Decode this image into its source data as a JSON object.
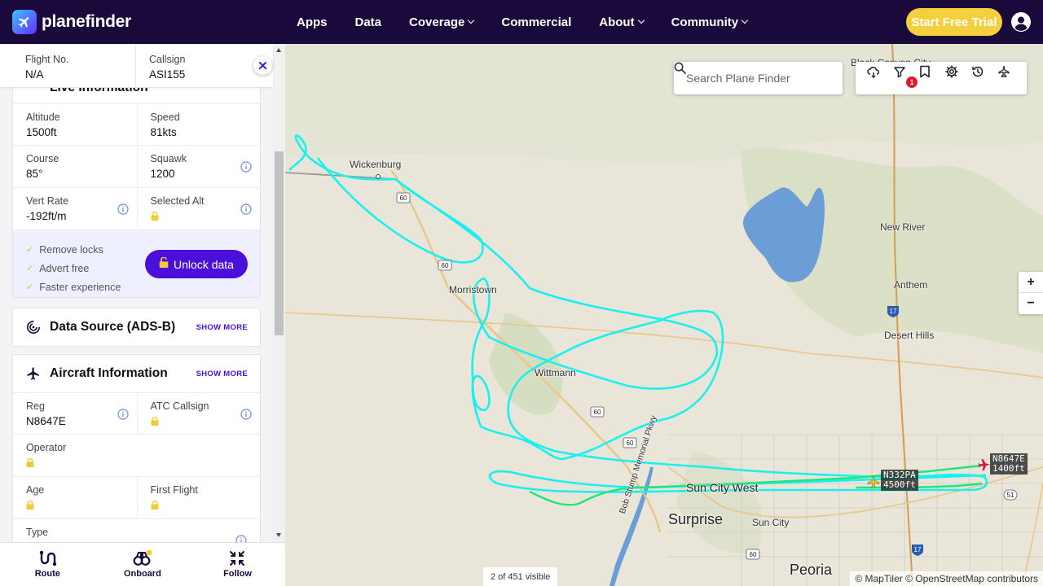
{
  "app": {
    "brand": "planefinder"
  },
  "nav": {
    "items": [
      {
        "label": "Apps",
        "dropdown": false
      },
      {
        "label": "Data",
        "dropdown": false
      },
      {
        "label": "Coverage",
        "dropdown": true
      },
      {
        "label": "Commercial",
        "dropdown": false
      },
      {
        "label": "About",
        "dropdown": true
      },
      {
        "label": "Community",
        "dropdown": true
      }
    ],
    "trial_label": "Start Free Trial"
  },
  "flight": {
    "flight_no_label": "Flight No.",
    "flight_no": "N/A",
    "callsign_label": "Callsign",
    "callsign": "ASI155",
    "section_title_partial": "Live Information"
  },
  "live": {
    "altitude_label": "Altitude",
    "altitude": "1500ft",
    "speed_label": "Speed",
    "speed": "81kts",
    "course_label": "Course",
    "course": "85°",
    "squawk_label": "Squawk",
    "squawk": "1200",
    "vert_rate_label": "Vert Rate",
    "vert_rate": "-192ft/m",
    "selected_alt_label": "Selected Alt"
  },
  "unlock": {
    "bullets": [
      "Remove locks",
      "Advert free",
      "Faster experience"
    ],
    "button_label": "Unlock data"
  },
  "data_source": {
    "title": "Data Source (ADS-B)",
    "show_more": "SHOW MORE"
  },
  "aircraft": {
    "title": "Aircraft Information",
    "show_more": "SHOW MORE",
    "reg_label": "Reg",
    "reg": "N8647E",
    "atc_label": "ATC Callsign",
    "operator_label": "Operator",
    "age_label": "Age",
    "first_flight_label": "First Flight",
    "type_label": "Type"
  },
  "bottom_bar": [
    {
      "label": "Route",
      "icon": "route-icon"
    },
    {
      "label": "Onboard",
      "icon": "binoculars-icon"
    },
    {
      "label": "Follow",
      "icon": "follow-icon"
    }
  ],
  "map": {
    "search_placeholder": "Search Plane Finder",
    "filter_badge": "1",
    "visible_count": "2 of 451 visible",
    "attribution": "© MapTiler © OpenStreetMap contributors",
    "zoom_in": "+",
    "zoom_out": "−",
    "towns": [
      "Wickenburg",
      "Morristown",
      "Wittmann",
      "Surprise",
      "Sun City West",
      "Sun City",
      "Peoria",
      "New River",
      "Anthem",
      "Desert Hills",
      "Black Canyon City",
      "Bob Stump Memorial Pkwy"
    ],
    "road_shields": [
      "60",
      "60",
      "60",
      "60",
      "60",
      "60",
      "17",
      "17",
      "51"
    ],
    "planes": [
      {
        "reg": "N8647E",
        "alt": "1400ft"
      },
      {
        "reg": "N332PA",
        "alt": "4500ft"
      }
    ]
  },
  "colors": {
    "nav_bg": "#1a0a3c",
    "accent": "#4a10d9",
    "trial": "#f4d03f",
    "track": "#19f0f0",
    "badge": "#e8162a"
  }
}
